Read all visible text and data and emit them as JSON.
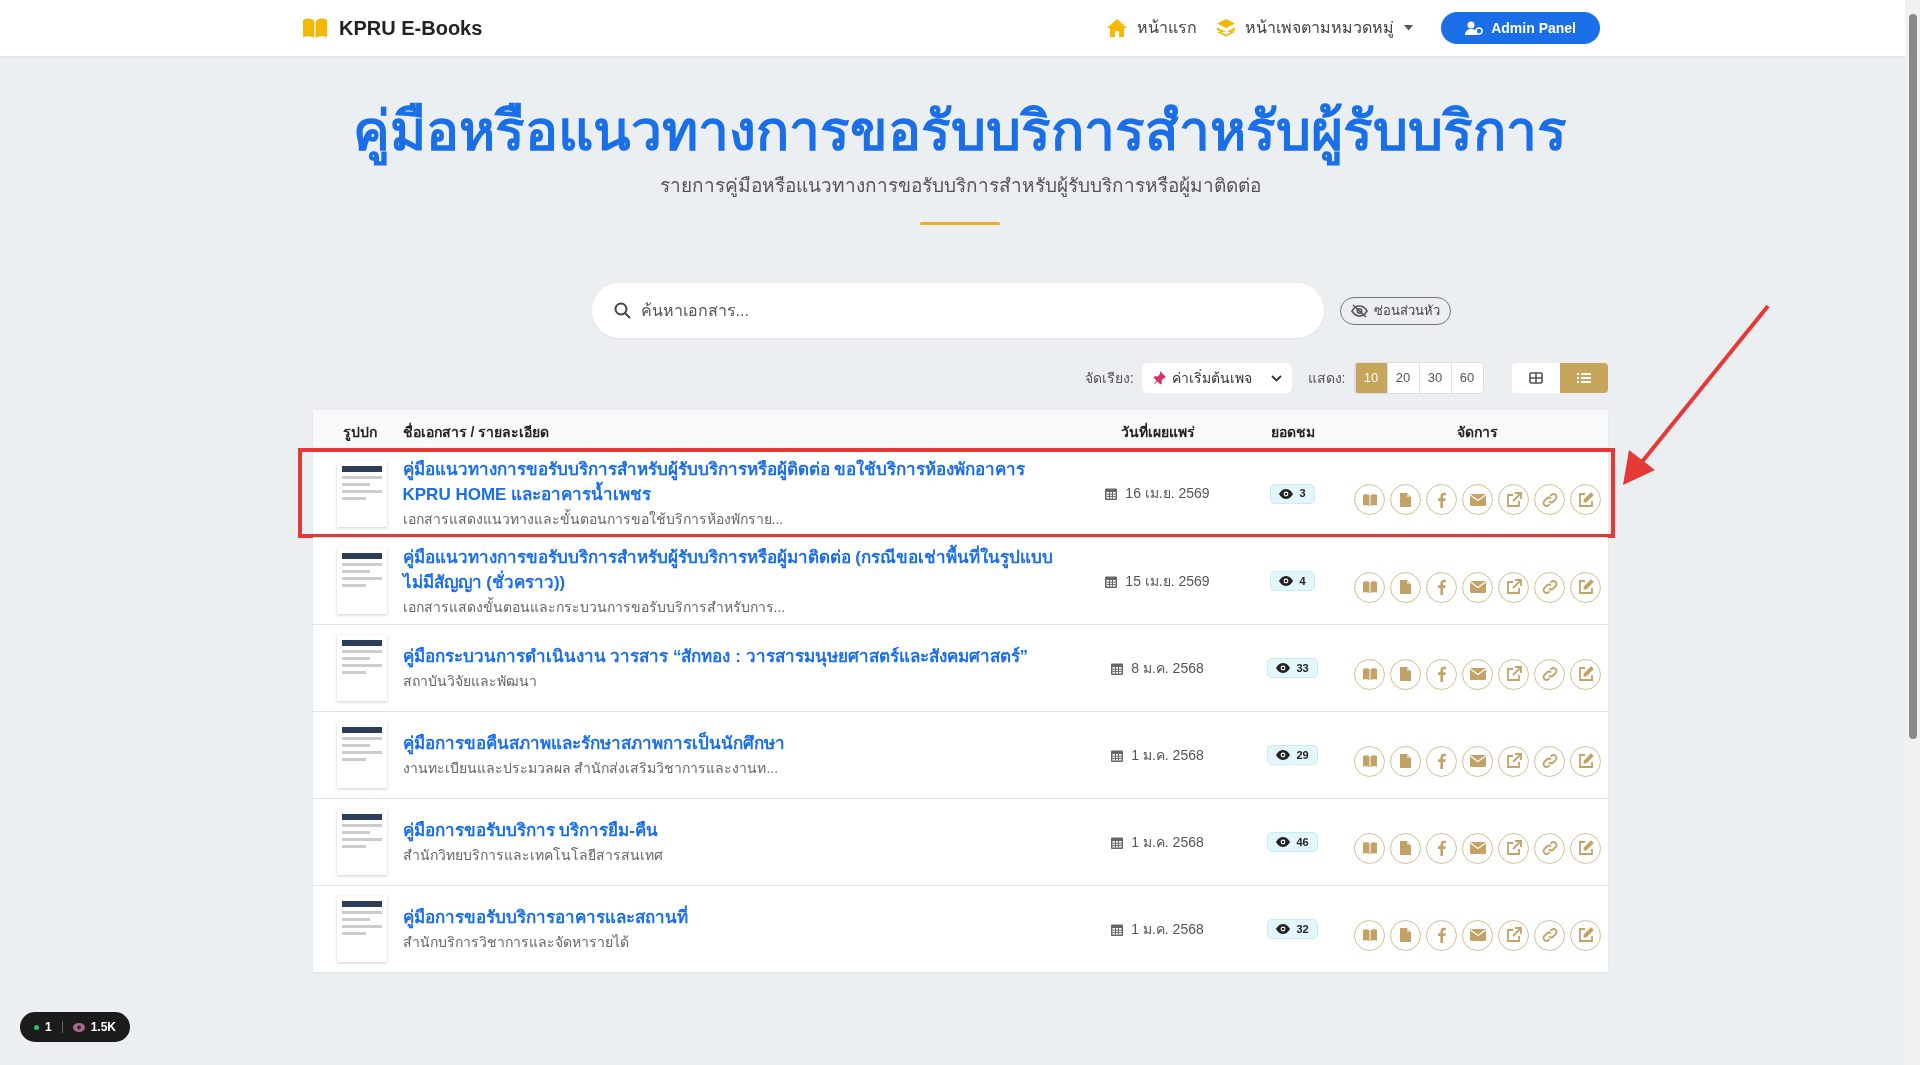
{
  "navbar": {
    "brand": "KPRU E-Books",
    "links": [
      {
        "label": "หน้าแรก",
        "kind": "home",
        "dropdown": false
      },
      {
        "label": "หน้าเพจตามหมวดหมู่",
        "kind": "category",
        "dropdown": true
      }
    ],
    "admin_button": "Admin Panel"
  },
  "hero": {
    "title": "คู่มือหรือแนวทางการขอรับบริการสำหรับผู้รับบริการ",
    "subtitle": "รายการคู่มือหรือแนวทางการขอรับบริการสำหรับผู้รับบริการหรือผู้มาติดต่อ"
  },
  "search": {
    "placeholder": "ค้นหาเอกสาร...",
    "hide_header_button": "ซ่อนส่วนหัว"
  },
  "toolbar": {
    "sort_label": "จัดเรียง:",
    "sort_value": "ค่าเริ่มต้นเพจ",
    "show_label": "แสดง:",
    "page_sizes": [
      {
        "label": "10",
        "selected": true
      },
      {
        "label": "20",
        "selected": false
      },
      {
        "label": "30",
        "selected": false
      },
      {
        "label": "60",
        "selected": false
      }
    ],
    "view_modes": [
      {
        "kind": "grid",
        "selected": false
      },
      {
        "kind": "list",
        "selected": true
      }
    ]
  },
  "table": {
    "columns": [
      "รูปปก",
      "ชื่อเอกสาร / รายละเอียด",
      "วันที่เผยแพร่",
      "ยอดชม",
      "จัดการ"
    ],
    "rows": [
      {
        "title": "คู่มือแนวทางการขอรับบริการสำหรับผู้รับบริการหรือผู้ติดต่อ ขอใช้บริการห้องพักอาคาร KPRU HOME และอาคารน้ำเพชร",
        "description": "เอกสารแสดงแนวทางและขั้นตอนการขอใช้บริการห้องพักราย...",
        "date": "16 เม.ย. 2569",
        "views": "3",
        "highlighted": true
      },
      {
        "title": "คู่มือแนวทางการขอรับบริการสำหรับผู้รับบริการหรือผู้มาติดต่อ (กรณีขอเช่าพื้นที่ในรูปแบบไม่มีสัญญา (ชั่วคราว))",
        "description": "เอกสารแสดงขั้นตอนและกระบวนการขอรับบริการสำหรับการ...",
        "date": "15 เม.ย. 2569",
        "views": "4",
        "highlighted": false
      },
      {
        "title": "คู่มือกระบวนการดำเนินงาน วารสาร “สักทอง : วารสารมนุษยศาสตร์และสังคมศาสตร์”",
        "description": "สถาบันวิจัยและพัฒนา",
        "date": "8 ม.ค. 2568",
        "views": "33",
        "highlighted": false
      },
      {
        "title": "คู่มือการขอคืนสภาพและรักษาสภาพการเป็นนักศึกษา",
        "description": "งานทะเบียนและประมวลผล สำนักส่งเสริมวิชาการและงานท...",
        "date": "1 ม.ค. 2568",
        "views": "29",
        "highlighted": false
      },
      {
        "title": "คู่มือการขอรับบริการ บริการยืม-คืน",
        "description": "สำนักวิทยบริการและเทคโนโลยีสารสนเทศ",
        "date": "1 ม.ค. 2568",
        "views": "46",
        "highlighted": false
      },
      {
        "title": "คู่มือการขอรับบริการอาคารและสถานที่",
        "description": "สำนักบริการวิชาการและจัดหารายได้",
        "date": "1 ม.ค. 2568",
        "views": "32",
        "highlighted": false
      }
    ]
  },
  "stats_badge": {
    "online": "1",
    "views": "1.5K"
  }
}
